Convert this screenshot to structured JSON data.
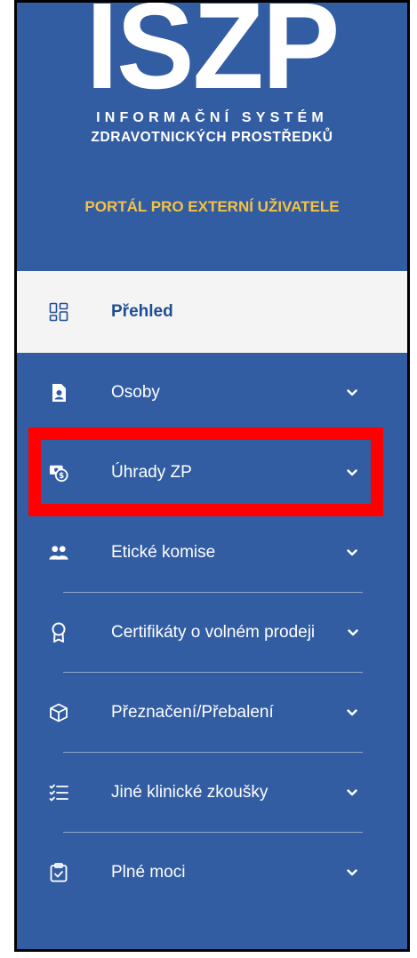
{
  "branding": {
    "logo_text": "ISZP",
    "subtitle_line1": "INFORMAČNÍ SYSTÉM",
    "subtitle_line2": "ZDRAVOTNICKÝCH PROSTŘEDKŮ",
    "portal_label": "PORTÁL PRO EXTERNÍ UŽIVATELE"
  },
  "colors": {
    "sidebar_bg": "#335da3",
    "active_bg": "#f4f4f4",
    "active_text": "#1f4d94",
    "portal_label": "#f5c242",
    "highlight": "#ff0000"
  },
  "nav": {
    "items": [
      {
        "label": "Přehled",
        "icon": "dashboard-icon",
        "active": true,
        "expandable": false
      },
      {
        "label": "Osoby",
        "icon": "person-document-icon",
        "active": false,
        "expandable": true
      },
      {
        "label": "Úhrady ZP",
        "icon": "payment-icon",
        "active": false,
        "expandable": true,
        "highlighted": true
      },
      {
        "label": "Etické komise",
        "icon": "people-icon",
        "active": false,
        "expandable": true
      },
      {
        "label": "Certifikáty o volném prodeji",
        "icon": "certificate-icon",
        "active": false,
        "expandable": true
      },
      {
        "label": "Přeznačení/Přebalení",
        "icon": "box-icon",
        "active": false,
        "expandable": true
      },
      {
        "label": "Jiné klinické zkoušky",
        "icon": "checklist-icon",
        "active": false,
        "expandable": true
      },
      {
        "label": "Plné moci",
        "icon": "clipboard-check-icon",
        "active": false,
        "expandable": true
      }
    ]
  }
}
